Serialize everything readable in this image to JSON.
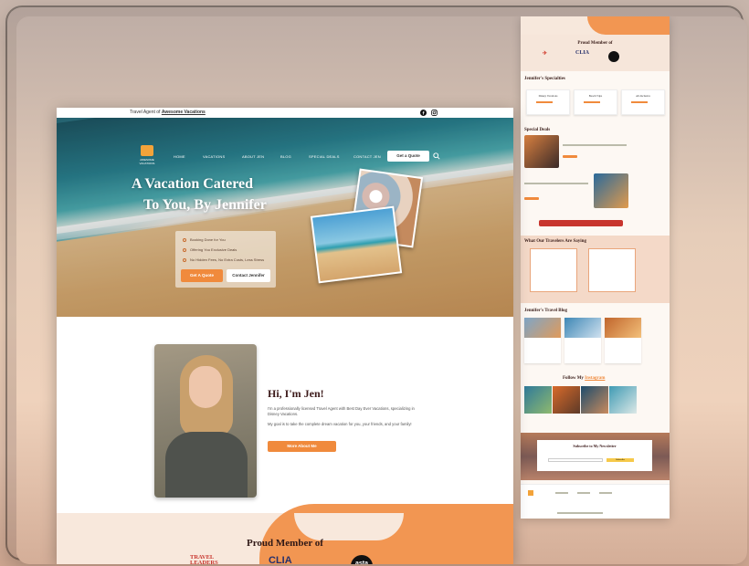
{
  "topbar": {
    "agent_prefix": "Travel Agent of",
    "agent_brand": "Awesome Vacations"
  },
  "nav": {
    "logo_text": "AWESOME VACATIONS",
    "items": [
      "HOME",
      "VACATIONS",
      "ABOUT JEN",
      "BLOG",
      "SPECIAL DEALS",
      "CONTACT JEN"
    ],
    "quote_button": "Get a Quote"
  },
  "hero": {
    "title_line1": "A Vacation Catered",
    "title_line2": "To You, By Jennifer",
    "features": [
      "Booking Done for You",
      "Offering You Exclusive Deals",
      "No Hidden Fees, No Extra Costs, Less Stress"
    ],
    "primary_button": "Get A Quote",
    "secondary_button": "Contact Jennifer"
  },
  "about": {
    "heading": "Hi, I'm Jen!",
    "paragraph1": "I'm a professionally licensed Travel Agent with Best Day Ever Vacations, specializing in Disney Vacations.",
    "paragraph2": "My goal is to take the complete dream vacation for you, your friends, and your family!",
    "button": "More About Me"
  },
  "member": {
    "heading": "Proud Member of",
    "logos": [
      "TRAVEL LEADERS NETWORK",
      "CLIA",
      "asta"
    ]
  },
  "preview": {
    "member_heading": "Proud Member of",
    "specialties_heading": "Jennifer's Specialties",
    "specialties": [
      "Disney Vacations",
      "Beach Trips",
      "All-Inclusive"
    ],
    "deals_heading": "Special Deals",
    "testimonials_heading": "What Our Travelers Are Saying",
    "blog_heading": "Jennifer's Travel Blog",
    "follow_prefix": "Follow My",
    "follow_link": "Instagram",
    "newsletter_heading": "Subscribe to My Newsletter",
    "subscribe_button": "Subscribe"
  },
  "colors": {
    "accent": "#f08a3c",
    "heading": "#3c1a1a",
    "cream": "#f8e8dc"
  }
}
